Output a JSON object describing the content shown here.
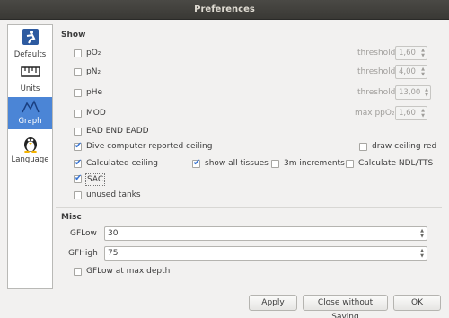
{
  "window": {
    "title": "Preferences"
  },
  "sidebar": {
    "items": [
      {
        "label": "Defaults",
        "icon": "diver-icon"
      },
      {
        "label": "Units",
        "icon": "ruler-icon"
      },
      {
        "label": "Graph",
        "icon": "graph-icon",
        "selected": true
      },
      {
        "label": "Language",
        "icon": "penguin-icon"
      }
    ]
  },
  "show": {
    "heading": "Show",
    "po2": {
      "label": "pO₂",
      "checked": false,
      "threshold_label": "threshold",
      "threshold_value": "1,60"
    },
    "pn2": {
      "label": "pN₂",
      "checked": false,
      "threshold_label": "threshold",
      "threshold_value": "4,00"
    },
    "phe": {
      "label": "pHe",
      "checked": false,
      "threshold_label": "threshold",
      "threshold_value": "13,00"
    },
    "mod": {
      "label": "MOD",
      "checked": false,
      "threshold_label": "max ppO₂",
      "threshold_value": "1,60"
    },
    "ead": {
      "label": "EAD END EADD",
      "checked": false
    },
    "dc_ceiling": {
      "label": "Dive computer reported ceiling",
      "checked": true
    },
    "draw_red": {
      "label": "draw ceiling red",
      "checked": false
    },
    "calc_ceiling": {
      "label": "Calculated ceiling",
      "checked": true
    },
    "all_tissues": {
      "label": "show all tissues",
      "checked": true
    },
    "increments": {
      "label": "3m increments",
      "checked": false
    },
    "ndl": {
      "label": "Calculate NDL/TTS",
      "checked": false
    },
    "sac": {
      "label": "SAC",
      "checked": true
    },
    "unused": {
      "label": "unused tanks",
      "checked": false
    }
  },
  "misc": {
    "heading": "Misc",
    "gflow": {
      "label": "GFLow",
      "value": "30"
    },
    "gfhigh": {
      "label": "GFHigh",
      "value": "75"
    },
    "gflow_max": {
      "label": "GFLow at max depth",
      "checked": false
    }
  },
  "buttons": {
    "apply": "Apply",
    "close": "Close without Saving",
    "ok": "OK"
  }
}
